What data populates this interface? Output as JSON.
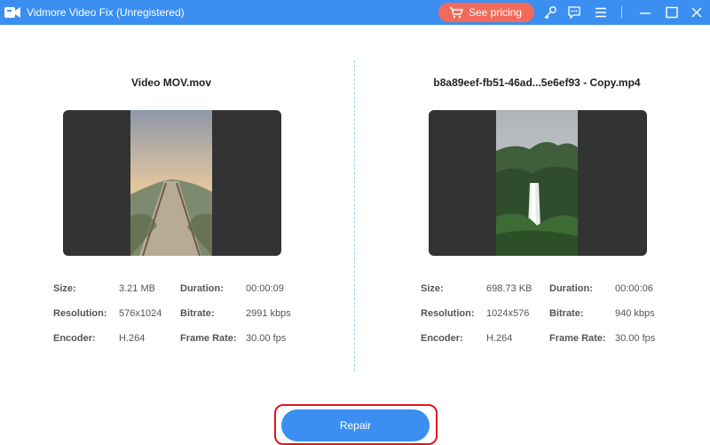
{
  "window": {
    "title": "Vidmore Video Fix (Unregistered)",
    "pricing_label": "See pricing",
    "icons": [
      "key-icon",
      "feedback-icon",
      "menu-icon",
      "minimize-icon",
      "maximize-icon",
      "close-icon"
    ]
  },
  "left": {
    "file_name": "Video MOV.mov",
    "info": {
      "size_label": "Size:",
      "size": "3.21 MB",
      "duration_label": "Duration:",
      "duration": "00:00:09",
      "resolution_label": "Resolution:",
      "resolution": "576x1024",
      "bitrate_label": "Bitrate:",
      "bitrate": "2991 kbps",
      "encoder_label": "Encoder:",
      "encoder": "H.264",
      "framerate_label": "Frame Rate:",
      "framerate": "30.00 fps"
    }
  },
  "right": {
    "file_name": "b8a89eef-fb51-46ad...5e6ef93 - Copy.mp4",
    "info": {
      "size_label": "Size:",
      "size": "698.73 KB",
      "duration_label": "Duration:",
      "duration": "00:00:06",
      "resolution_label": "Resolution:",
      "resolution": "1024x576",
      "bitrate_label": "Bitrate:",
      "bitrate": "940 kbps",
      "encoder_label": "Encoder:",
      "encoder": "H.264",
      "framerate_label": "Frame Rate:",
      "framerate": "30.00 fps"
    }
  },
  "actions": {
    "repair_label": "Repair"
  },
  "colors": {
    "accent": "#3a8ff0",
    "pricing": "#f36a5a",
    "highlight": "#e0141e"
  }
}
